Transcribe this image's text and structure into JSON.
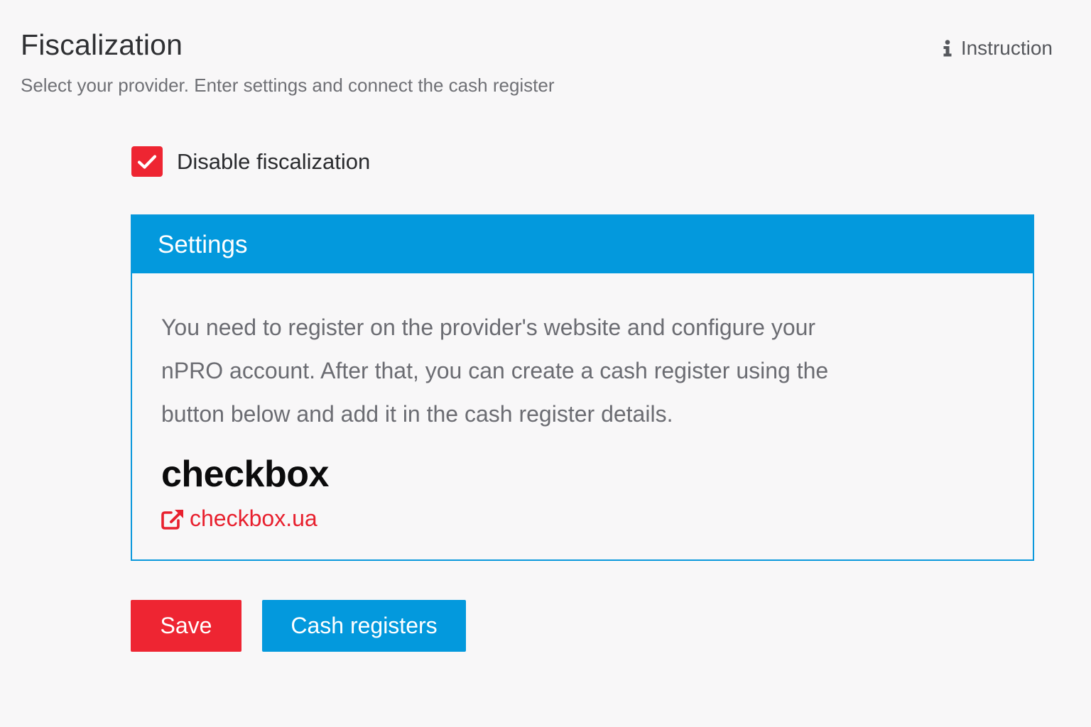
{
  "header": {
    "title": "Fiscalization",
    "subtitle": "Select your provider. Enter settings and connect the cash register",
    "instruction_label": "Instruction",
    "instruction_icon": "info-icon"
  },
  "disable_fiscalization": {
    "label": "Disable fiscalization",
    "checked": true,
    "color": "#ee2532"
  },
  "settings": {
    "title": "Settings",
    "header_color": "#0399dd",
    "description": "You need to register on the provider's website and configure your nPRO account. After that, you can create a cash register using the button below and add it in the cash register details.",
    "provider_name": "checkbox",
    "provider_link_label": "checkbox.ua",
    "provider_link_icon": "external-link-icon",
    "link_color": "#e8202e"
  },
  "actions": {
    "save_label": "Save",
    "save_color": "#ee2532",
    "cash_registers_label": "Cash registers",
    "cash_registers_color": "#0399dd"
  }
}
